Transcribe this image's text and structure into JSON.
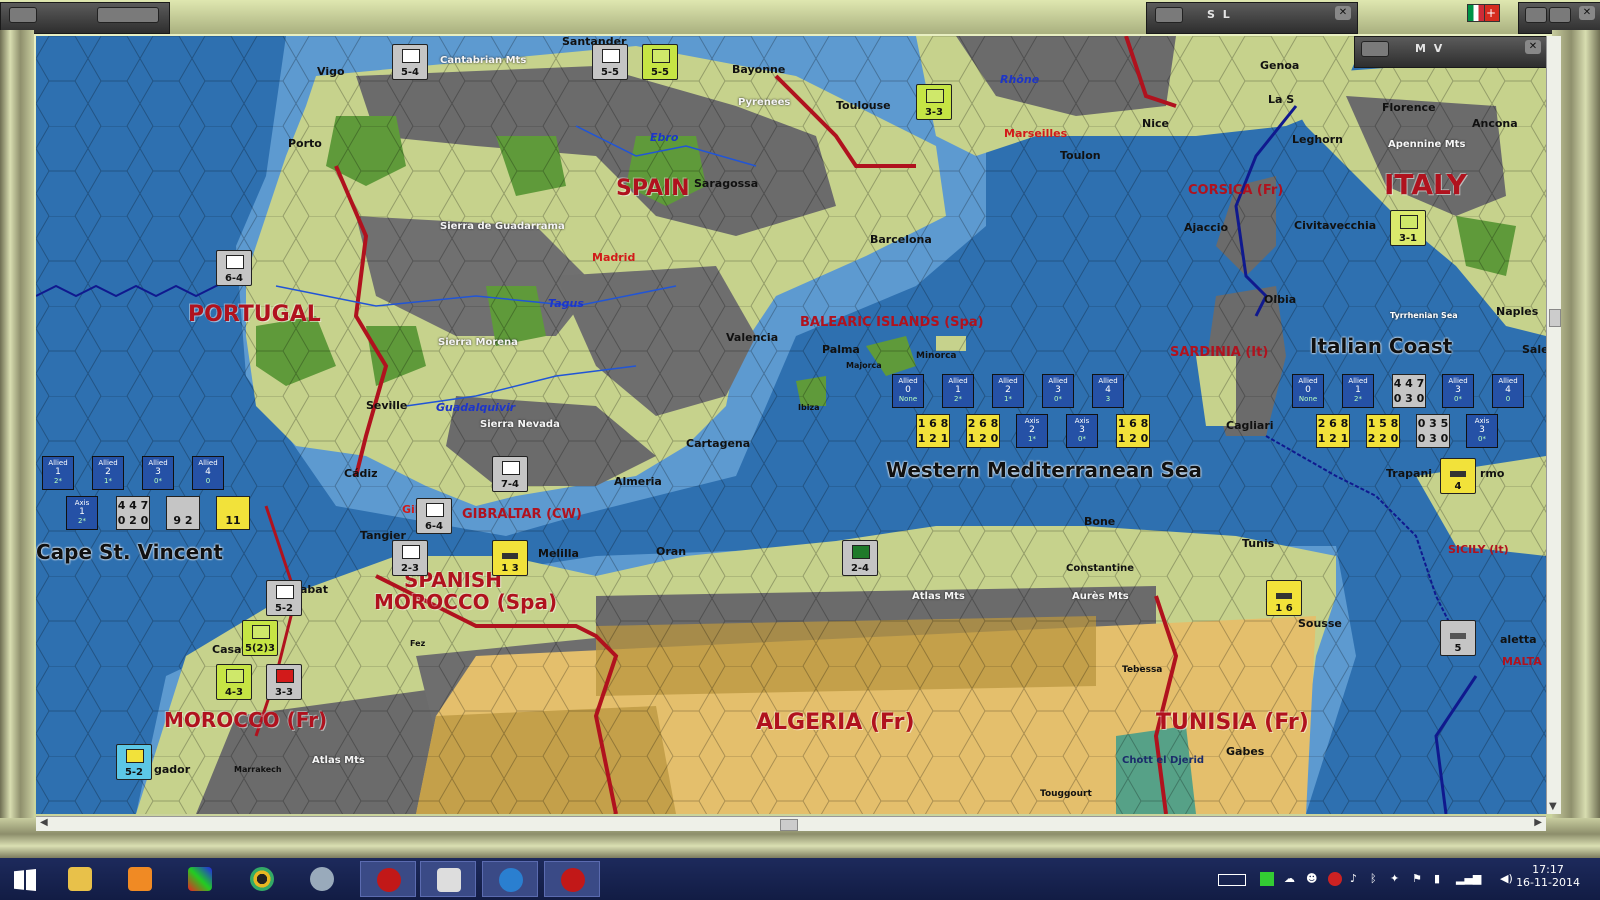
{
  "windows": {
    "sl_title": "S L",
    "mv_title": "M V"
  },
  "map": {
    "countries": [
      {
        "key": "spain",
        "text": "SPAIN"
      },
      {
        "key": "portugal",
        "text": "PORTUGAL"
      },
      {
        "key": "italy",
        "text": "ITALY"
      },
      {
        "key": "spanish_morocco_1",
        "text": "SPANISH"
      },
      {
        "key": "spanish_morocco_2",
        "text": "MOROCCO (Spa)"
      },
      {
        "key": "morocco",
        "text": "MOROCCO (Fr)"
      },
      {
        "key": "algeria",
        "text": "ALGERIA (Fr)"
      },
      {
        "key": "tunisia",
        "text": "TUNISIA (Fr)"
      }
    ],
    "seas": {
      "western_med": "Western Mediterranean Sea",
      "italian_coast": "Italian Coast",
      "cape_st_vincent": "Cape St. Vincent"
    },
    "islands": {
      "balearic": "BALEARIC ISLANDS (Spa)",
      "corsica": "CORSICA (Fr)",
      "sardinia": "SARDINIA (It)",
      "sicily": "SICILY (It)",
      "gibraltar": "GIBRALTAR (CW)",
      "malta": "MALTA"
    },
    "cities": {
      "vigo": "Vigo",
      "porto": "Porto",
      "santander": "Santander",
      "bayonne": "Bayonne",
      "toulouse": "Toulouse",
      "genoa": "Genoa",
      "nice": "Nice",
      "toulon": "Toulon",
      "marseilles": "Marseilles",
      "florence": "Florence",
      "ancona": "Ancona",
      "leghorn": "Leghorn",
      "saragossa": "Saragossa",
      "barcelona": "Barcelona",
      "madrid": "Madrid",
      "valencia": "Valencia",
      "seville": "Seville",
      "cadiz": "Cádiz",
      "cartagena": "Cartagena",
      "almeria": "Almeria",
      "tangier": "Tangier",
      "melilla": "Melilla",
      "oran": "Oran",
      "bone": "Bone",
      "tunis": "Tunis",
      "constantine": "Constantine",
      "sousse": "Sousse",
      "tebessa": "Tebessa",
      "gabes": "Gabes",
      "touggourt": "Touggourt",
      "ajaccio": "Ajaccio",
      "civitavecchia": "Civitavecchia",
      "olbia": "Olbia",
      "cagliari": "Cagliari",
      "naples": "Naples",
      "palma": "Palma",
      "minorca": "Minorca",
      "majorca": "Majorca",
      "ibiza": "Ibiza",
      "trapani": "Trapani",
      "rabat": "abat",
      "casa": "Casa",
      "agadir": "gador",
      "marrakech": "Marrakech",
      "fez": "Fez",
      "salerno": "Sale",
      "valletta": "aletta",
      "la_spezia": "La S",
      "palermo": "rmo",
      "gibraltar_town": "Gib"
    },
    "features": {
      "cantabrian": "Cantabrian Mts",
      "pyrenees": "Pyrenees",
      "guadarrama": "Sierra de Guadarrama",
      "morena": "Sierra Morena",
      "nevada": "Sierra Nevada",
      "atlas1": "Atlas Mts",
      "atlas2": "Atlas Mts",
      "aures": "Aurès Mts",
      "apennine": "Apennine Mts",
      "chott": "Chott el Djerid",
      "tyrrhenian": "Tyrrhenian Sea"
    },
    "rivers": {
      "ebro": "Ebro",
      "tagus": "Tagus",
      "guadalquivir": "Guadalquivir",
      "rhone": "Rhône"
    },
    "counters": [
      {
        "key": "c1",
        "value": "5-4",
        "color": "grey"
      },
      {
        "key": "c2",
        "value": "5-5",
        "color": "grey"
      },
      {
        "key": "c3",
        "value": "5-5",
        "color": "green"
      },
      {
        "key": "c4",
        "value": "6-4",
        "color": "grey"
      },
      {
        "key": "c5",
        "value": "3-3",
        "color": "green"
      },
      {
        "key": "c6",
        "value": "7-4",
        "color": "grey"
      },
      {
        "key": "c7",
        "value": "6-4",
        "color": "grey"
      },
      {
        "key": "c8",
        "value": "2-3",
        "color": "grey"
      },
      {
        "key": "c9",
        "value": "2-4",
        "color": "grey"
      },
      {
        "key": "c10",
        "value": "5-2",
        "color": "grey"
      },
      {
        "key": "c11",
        "value": "4-3",
        "color": "green"
      },
      {
        "key": "c12",
        "value": "3-3",
        "color": "grey"
      },
      {
        "key": "c13",
        "value": "5(2)3",
        "color": "green"
      },
      {
        "key": "c14",
        "value": "5-2",
        "color": "cyan"
      },
      {
        "key": "c15",
        "value": "3-1",
        "color": "green"
      },
      {
        "key": "c16",
        "value": "1 3",
        "color": "yellow"
      },
      {
        "key": "c17",
        "value": "1 6",
        "color": "yellow"
      },
      {
        "key": "c18",
        "value": "4",
        "color": "yellow"
      },
      {
        "key": "c19",
        "value": "5",
        "color": "grey"
      }
    ],
    "info_wm": [
      {
        "a": "Allied",
        "n": "0",
        "s": "None"
      },
      {
        "a": "Allied",
        "n": "1",
        "s": "2*"
      },
      {
        "a": "Allied",
        "n": "2",
        "s": "1*"
      },
      {
        "a": "Allied",
        "n": "3",
        "s": "0*"
      },
      {
        "a": "Allied",
        "n": "4",
        "s": "3"
      }
    ],
    "info_wm_axis": [
      {
        "t": "1 6 8",
        "b": "1 2 1"
      },
      {
        "t": "2 6 8",
        "b": "1 2 0"
      },
      {
        "a": "Axis",
        "n": "2",
        "s": "1*"
      },
      {
        "a": "Axis",
        "n": "3",
        "s": "0*"
      },
      {
        "t": "1 6 8",
        "b": "1 2 0"
      }
    ],
    "info_ic": [
      {
        "a": "Allied",
        "n": "0",
        "s": "None"
      },
      {
        "a": "Allied",
        "n": "1",
        "s": "2*"
      },
      {
        "t": "4 4 7",
        "b": "0 3 0"
      },
      {
        "a": "Allied",
        "n": "3",
        "s": "0*"
      },
      {
        "a": "Allied",
        "n": "4",
        "s": "0"
      }
    ],
    "info_ic_axis": [
      {
        "t": "2 6 8",
        "b": "1 2 1"
      },
      {
        "t": "1 5 8",
        "b": "2 2 0"
      },
      {
        "t": "0 3 5",
        "b": "0 3 0"
      },
      {
        "a": "Axis",
        "n": "3",
        "s": "0*"
      }
    ],
    "info_csv": [
      {
        "a": "Allied",
        "n": "1",
        "s": "2*"
      },
      {
        "a": "Allied",
        "n": "2",
        "s": "1*"
      },
      {
        "a": "Allied",
        "n": "3",
        "s": "0*"
      },
      {
        "a": "Allied",
        "n": "4",
        "s": "0"
      }
    ],
    "info_csv_axis": [
      {
        "a": "Axis",
        "n": "1",
        "s": "2*"
      },
      {
        "t": "4 4 7",
        "b": "0 2 0"
      },
      {
        "t": "9 2",
        "b": ""
      },
      {
        "t": "11",
        "b": ""
      }
    ],
    "colors": {
      "sea": "#2e70b0",
      "shallow": "#5d9ad0",
      "clear": "#c6d28c",
      "forest": "#5f9a3a",
      "mountain": "#6b6b6b",
      "desert": "#e4bf6c",
      "border": "#b0121e"
    }
  },
  "taskbar": {
    "time": "17:17",
    "date": "16-11-2014"
  }
}
